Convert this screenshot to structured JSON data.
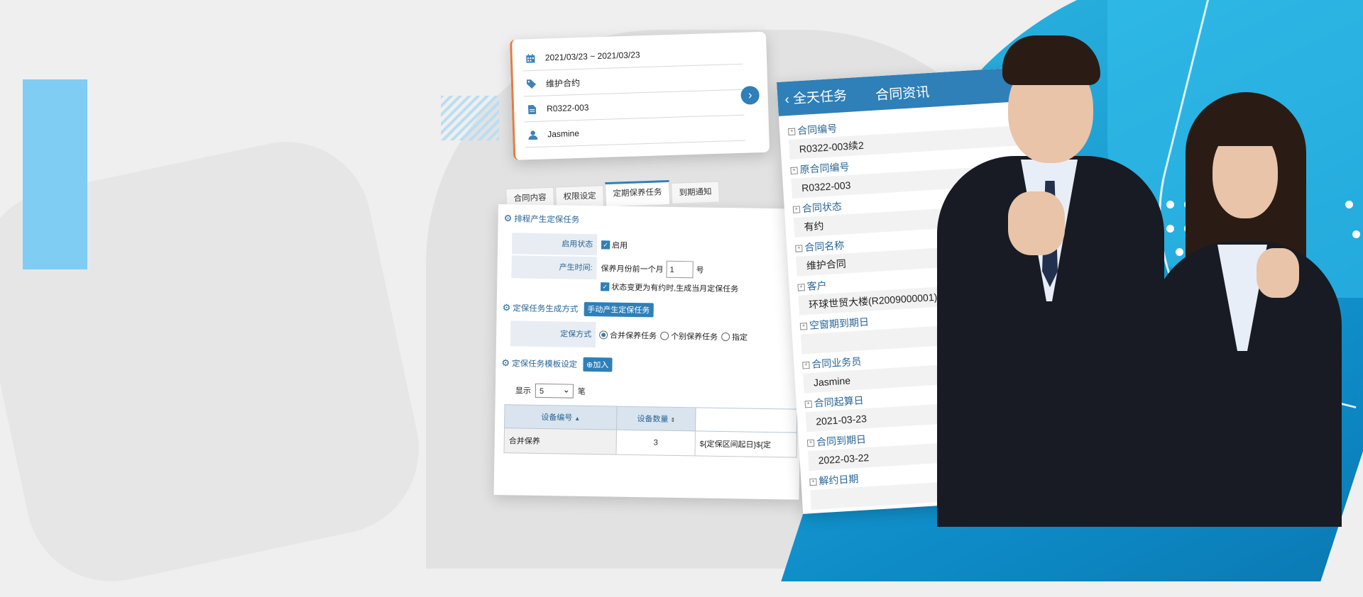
{
  "filter_card": {
    "date_range": "2021/03/23 ~ 2021/03/23",
    "contract_type": "维护合约",
    "contract_no": "R0322-003",
    "person": "Jasmine",
    "icons": [
      "calendar-icon",
      "tag-icon",
      "document-icon",
      "user-icon",
      "chevron-right-icon"
    ]
  },
  "tabs": [
    "合同内容",
    "权限设定",
    "定期保养任务",
    "到期通知"
  ],
  "active_tab": "定期保养任务",
  "schedule": {
    "section_title": "排程产生定保任务",
    "enable_label": "启用状态",
    "enable_value": "启用",
    "time_label": "产生时间:",
    "time_prefix": "保养月份前一个月",
    "time_day": "1",
    "time_suffix": "号",
    "status_change_text": "状态变更为有约时,生成当月定保任务"
  },
  "generation": {
    "section_title": "定保任务生成方式",
    "manual_button": "手动产生定保任务",
    "method_label": "定保方式",
    "options": [
      "合并保养任务",
      "个别保养任务",
      "指定"
    ],
    "selected": "合并保养任务"
  },
  "template": {
    "section_title": "定保任务模板设定",
    "add_button": "加入",
    "show_label": "显示",
    "show_value": "5",
    "show_suffix": "笔",
    "columns": [
      "设备编号",
      "设备数量",
      ""
    ],
    "rows": [
      [
        "合并保养",
        "3",
        "${定保区间起日}${定"
      ]
    ]
  },
  "contract_info": {
    "back_label": "全天任务",
    "title": "合同资讯",
    "fields": [
      {
        "label": "合同编号",
        "value": "R0322-003续2"
      },
      {
        "label": "原合同编号",
        "value": "R0322-003"
      },
      {
        "label": "合同状态",
        "value": "有约"
      },
      {
        "label": "合同名称",
        "value": "维护合同"
      },
      {
        "label": "客户",
        "value": "环球世贸大楼(R2009000001)"
      },
      {
        "label": "空窗期到期日",
        "value": ""
      },
      {
        "label": "合同业务员",
        "value": "Jasmine"
      },
      {
        "label": "合同起算日",
        "value": "2021-03-23"
      },
      {
        "label": "合同到期日",
        "value": "2022-03-22"
      },
      {
        "label": "解约日期",
        "value": ""
      }
    ]
  },
  "colors": {
    "accent": "#2f7fb8",
    "orange": "#e77b3f",
    "light_blue": "#7fcdf3",
    "bg_blue": "#1aa1d8"
  }
}
